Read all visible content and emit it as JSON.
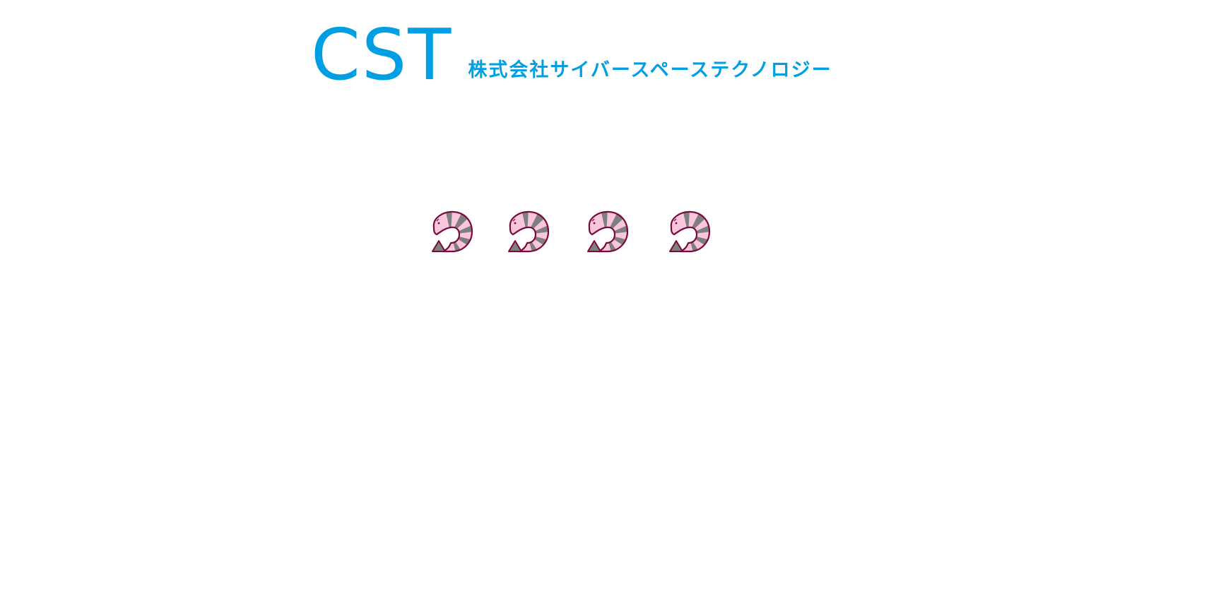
{
  "header": {
    "logo_text": "CST",
    "company_name": "株式会社サイバースペーステクノロジー"
  },
  "loader": {
    "icon": "shrimp-icon",
    "count": 4
  },
  "colors": {
    "brand": "#009fe3",
    "outline": "#7a0a3c",
    "pink": "#f9c6dc",
    "gray": "#7f7f7f"
  }
}
